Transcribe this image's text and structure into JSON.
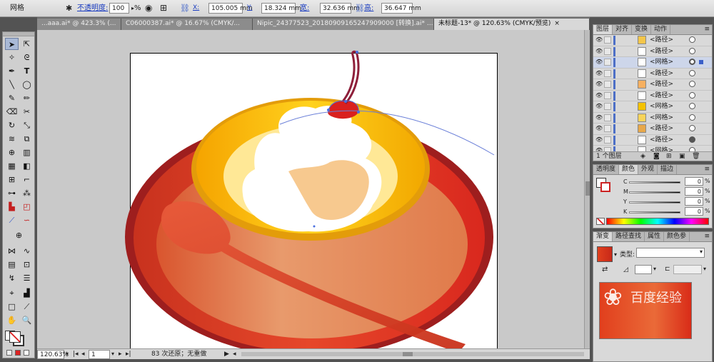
{
  "control_bar": {
    "object_type": "网格",
    "opacity_label": "不透明度:",
    "opacity_value": "100",
    "percent": "%",
    "x_label": "X:",
    "x_value": "105.005 mm",
    "y_label": "Y:",
    "y_value": "18.324 mm",
    "w_label": "宽:",
    "w_value": "32.636 mm",
    "h_label": "高:",
    "h_value": "36.647 mm"
  },
  "tabs": [
    {
      "label": "...aaa.ai* @ 423.3% (...",
      "active": false
    },
    {
      "label": "C06000387.ai* @ 16.67% (CMYK/...",
      "active": false
    },
    {
      "label": "Nipic_24377523_20180909165247909000 [转换].ai* ...",
      "active": false
    },
    {
      "label": "未标题-13* @ 120.63% (CMYK/预览)",
      "active": true
    }
  ],
  "status_bar": {
    "zoom": "120.63%",
    "page": "1",
    "message": "83 次还原；无重做"
  },
  "layers_panel": {
    "tabs": [
      "图层",
      "对齐",
      "变换",
      "动作"
    ],
    "rows": [
      {
        "name": "<路径>",
        "target": "empty",
        "selected": false
      },
      {
        "name": "<路径>",
        "target": "empty",
        "selected": false
      },
      {
        "name": "<网格>",
        "target": "ring",
        "selected": true
      },
      {
        "name": "<路径>",
        "target": "empty",
        "selected": false
      },
      {
        "name": "<路径>",
        "target": "empty",
        "selected": false
      },
      {
        "name": "<路径>",
        "target": "empty",
        "selected": false
      },
      {
        "name": "<网格>",
        "target": "empty",
        "selected": false
      },
      {
        "name": "<网格>",
        "target": "empty",
        "selected": false
      },
      {
        "name": "<路径>",
        "target": "empty",
        "selected": false
      },
      {
        "name": "<路径>",
        "target": "filled",
        "selected": false
      },
      {
        "name": "<网格>",
        "target": "empty",
        "selected": false
      }
    ],
    "footer_count": "1 个图层"
  },
  "color_panel": {
    "tabs": [
      "透明度",
      "颜色",
      "外观",
      "描边"
    ],
    "channels": [
      {
        "label": "C",
        "value": "0"
      },
      {
        "label": "M",
        "value": "0"
      },
      {
        "label": "Y",
        "value": "0"
      },
      {
        "label": "K",
        "value": "0"
      }
    ],
    "percent": "%"
  },
  "gradient_panel": {
    "tabs": [
      "渐变",
      "路径查找",
      "属性",
      "颜色参"
    ],
    "type_label": "类型:",
    "type_value": ""
  },
  "watermark": "百度经验"
}
